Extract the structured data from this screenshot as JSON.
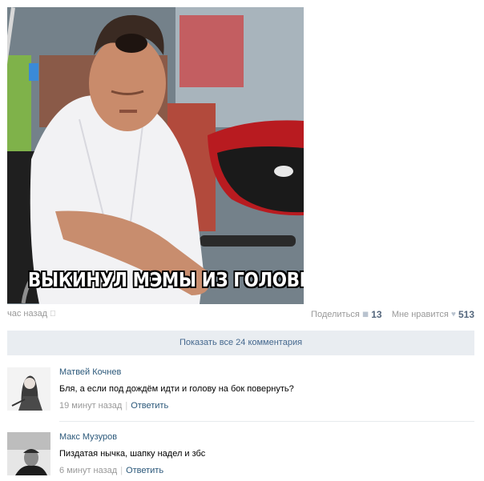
{
  "post": {
    "caption": "ВЫКИНУЛ МЭМЫ ИЗ ГОЛОВЫ",
    "time": "час назад",
    "share_label": "Поделиться",
    "share_count": "13",
    "like_label": "Мне нравится",
    "like_count": "513",
    "icons": {
      "device": "apple-icon",
      "share": "megaphone-icon",
      "like": "heart-icon"
    }
  },
  "comments_bar": {
    "label": "Показать все 24 комментария"
  },
  "comments": [
    {
      "author": "Матвей Кочнев",
      "text": "Бля, а если под дождём идти и голову на бок повернуть?",
      "time": "19 минут назад",
      "reply": "Ответить"
    },
    {
      "author": "Макс Музуров",
      "text": "Пиздатая нычка, шапку надел и збс",
      "time": "6 минут назад",
      "reply": "Ответить"
    }
  ],
  "colors": {
    "link": "#2b587a",
    "muted": "#999999",
    "bar_bg": "#e9edf1",
    "bar_text": "#45688e"
  }
}
